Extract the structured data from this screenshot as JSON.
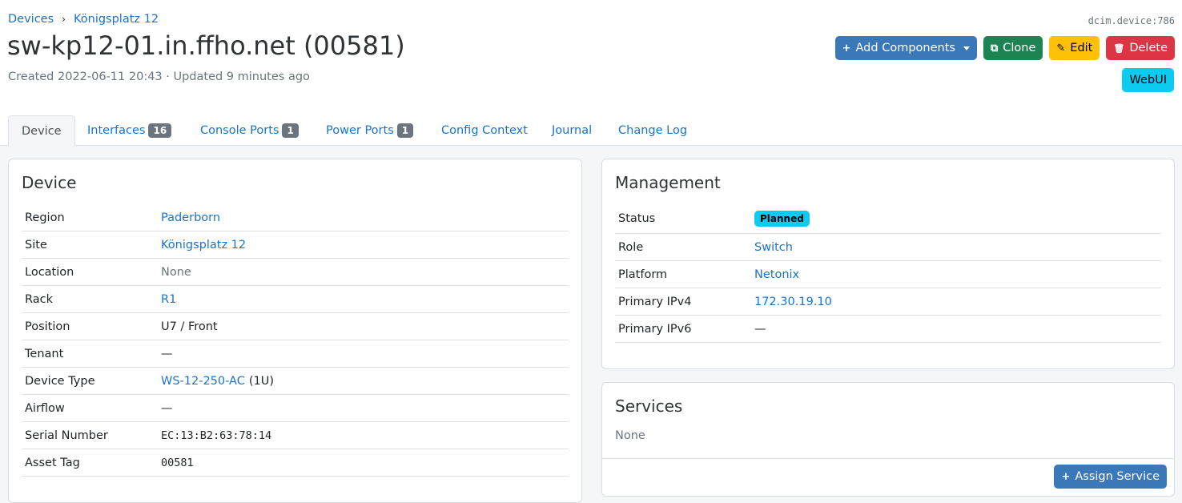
{
  "breadcrumb": {
    "items": [
      "Devices",
      "Königsplatz 12"
    ],
    "separator": "›"
  },
  "object_id": "dcim.device:786",
  "title": "sw-kp12-01.in.ffho.net (00581)",
  "meta": {
    "created": "Created 2022-06-11 20:43",
    "updated": "Updated 9 minutes ago",
    "dot": "·"
  },
  "actions": {
    "add_components": "Add Components",
    "clone": "Clone",
    "edit": "Edit",
    "delete": "Delete",
    "webui": "WebUI",
    "icons": {
      "add": "+",
      "clone": "⧉",
      "edit": "✎",
      "delete": "🗑"
    }
  },
  "tabs": [
    {
      "label": "Device",
      "active": true
    },
    {
      "label": "Interfaces",
      "badge": "16"
    },
    {
      "label": "Console Ports",
      "badge": "1"
    },
    {
      "label": "Power Ports",
      "badge": "1"
    },
    {
      "label": "Config Context"
    },
    {
      "label": "Journal"
    },
    {
      "label": "Change Log"
    }
  ],
  "device_card": {
    "title": "Device",
    "rows": [
      {
        "label": "Region",
        "value": "Paderborn",
        "link": true
      },
      {
        "label": "Site",
        "value": "Königsplatz 12",
        "link": true
      },
      {
        "label": "Location",
        "value": "None",
        "muted": true
      },
      {
        "label": "Rack",
        "value": "R1",
        "link": true
      },
      {
        "label": "Position",
        "value": "U7 / Front"
      },
      {
        "label": "Tenant",
        "value": "—"
      },
      {
        "label": "Device Type",
        "value": "WS-12-250-AC",
        "suffix": "(1U)",
        "link": true
      },
      {
        "label": "Airflow",
        "value": "—"
      },
      {
        "label": "Serial Number",
        "value": "EC:13:B2:63:78:14",
        "mono": true
      },
      {
        "label": "Asset Tag",
        "value": "00581",
        "mono": true
      }
    ]
  },
  "management_card": {
    "title": "Management",
    "rows": [
      {
        "label": "Status",
        "value": "Planned",
        "badge": true
      },
      {
        "label": "Role",
        "value": "Switch",
        "link": true
      },
      {
        "label": "Platform",
        "value": "Netonix",
        "link": true
      },
      {
        "label": "Primary IPv4",
        "value": "172.30.19.10",
        "link": true
      },
      {
        "label": "Primary IPv6",
        "value": "—"
      }
    ]
  },
  "services_card": {
    "title": "Services",
    "empty": "None",
    "assign_label": "Assign Service"
  },
  "colors": {
    "link": "#1a73c8",
    "primary": "#3b78b8",
    "success": "#1e8352",
    "warning": "#ffc107",
    "danger": "#dc3545",
    "info": "#0dcaf0"
  }
}
